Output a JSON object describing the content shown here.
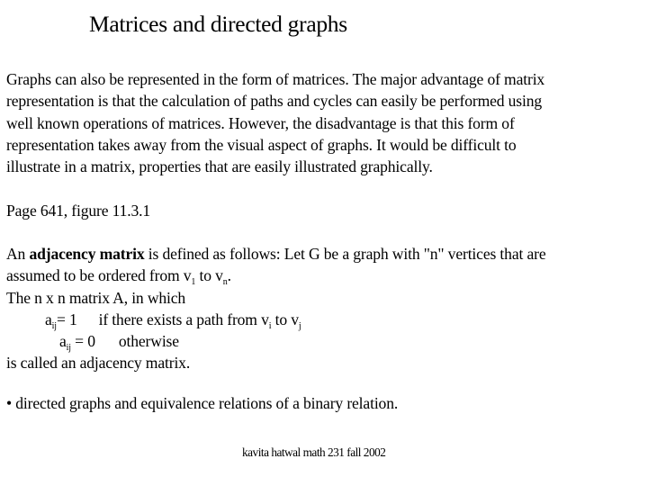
{
  "slide": {
    "title": "Matrices and directed graphs",
    "intro_lines": [
      "Graphs can also be represented in the form of matrices.  The major advantage of matrix",
      "representation is that the calculation of paths and cycles can easily be performed using",
      "well known operations of matrices. However, the disadvantage is that this form of",
      "representation takes away from the visual aspect of graphs.  It would be difficult to",
      "illustrate in a matrix, properties that are easily illustrated graphically."
    ],
    "reference": "Page 641, figure 11.3.1",
    "definition": {
      "line1_prefix": "An ",
      "line1_bold": "adjacency matrix",
      "line1_suffix": " is defined as follows:  Let G be a graph with \"n\" vertices that are",
      "line2_prefix": "assumed to be ordered from v",
      "line2_sub1": "1",
      "line2_mid": " to v",
      "line2_sub2": "n",
      "line2_end": ".",
      "line3": "The n x n matrix A, in which",
      "case1": {
        "var": "a",
        "sub": "ij",
        "eq": "= 1",
        "cond_prefix": "if there exists a path from v",
        "cond_sub1": "i",
        "cond_mid": " to v",
        "cond_sub2": "j"
      },
      "case2": {
        "var": "a",
        "sub": "ij",
        "eq": " = 0",
        "cond": "otherwise"
      },
      "closing": "is called an adjacency matrix."
    },
    "bullet": {
      "symbol": "•",
      "text": " directed graphs and equivalence relations of a binary relation."
    },
    "footer": "kavita hatwal math 231 fall 2002"
  }
}
